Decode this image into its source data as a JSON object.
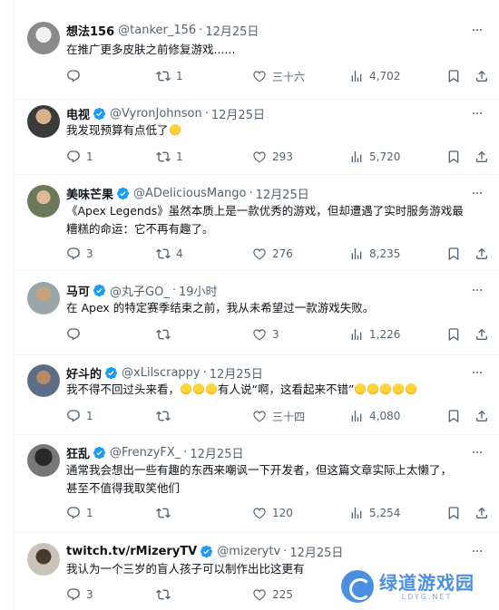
{
  "tweets": [
    {
      "name": "想法156",
      "handle": "@tanker_156",
      "date": "12月25日",
      "text": [
        "在推广更多皮肤之前修复游戏......"
      ],
      "replies": "",
      "retweets": "1",
      "likes": "三十六",
      "views": "4,702"
    },
    {
      "name": "电视",
      "handle": "@VyronJohnson",
      "date": "12月25日",
      "text": [
        "我发现预算有点低了"
      ],
      "emoji_after": 1,
      "replies": "1",
      "retweets": "1",
      "likes": "293",
      "views": "5,720"
    },
    {
      "name": "美味芒果",
      "handle": "@ADeliciousMango",
      "date": "12月25日",
      "text": [
        "《Apex Legends》虽然本质上是一款优秀的游戏，但却遭遇了实时服务游戏最",
        "糟糕的命运：它不再有趣了。"
      ],
      "replies": "3",
      "retweets": "4",
      "likes": "276",
      "views": "8,235"
    },
    {
      "name": "马可",
      "handle": "@丸子GO_",
      "date": "19小时",
      "text": [
        "在 Apex 的特定赛季结束之前，我从未希望过一款游戏失败。"
      ],
      "replies": "",
      "retweets": "",
      "likes": "3",
      "views": "1,226"
    },
    {
      "name": "好斗的",
      "handle": "@xLilscrappy",
      "date": "12月25日",
      "text_parts": {
        "a": "我不得不回过头来看，",
        "b": "有人说“啊，这看起来不错”"
      },
      "replies": "1",
      "retweets": "",
      "likes": "三十四",
      "views": "4,080"
    },
    {
      "name": "狂乱",
      "handle": "@FrenzyFX_",
      "date": "12月25日",
      "text": [
        "通常我会想出一些有趣的东西来嘲讽一下开发者，但这篇文章实际上太懒了，",
        "甚至不值得我取笑他们"
      ],
      "replies": "1",
      "retweets": "",
      "likes": "120",
      "views": "5,254"
    },
    {
      "name": "twitch.tv/rMizeryTV",
      "handle": "@mizerytv",
      "date": "12月25日",
      "text": [
        "我认为一个三岁的盲人孩子可以制作出比这更有"
      ],
      "replies": "3",
      "retweets": "",
      "likes": "225",
      "views": ""
    }
  ],
  "watermark": {
    "title": "绿道游戏园",
    "sub": "LDYG.NET"
  },
  "icons": {
    "reply": "reply-icon",
    "retweet": "retweet-icon",
    "like": "heart-icon",
    "views": "views-icon",
    "bookmark": "bookmark-icon",
    "share": "share-icon",
    "verified": "verified-badge-icon",
    "more": "more-icon"
  },
  "colors": {
    "verified": "#1d9bf0",
    "muted": "#536471",
    "text": "#0f1419",
    "watermark": "#4a8fe0"
  }
}
